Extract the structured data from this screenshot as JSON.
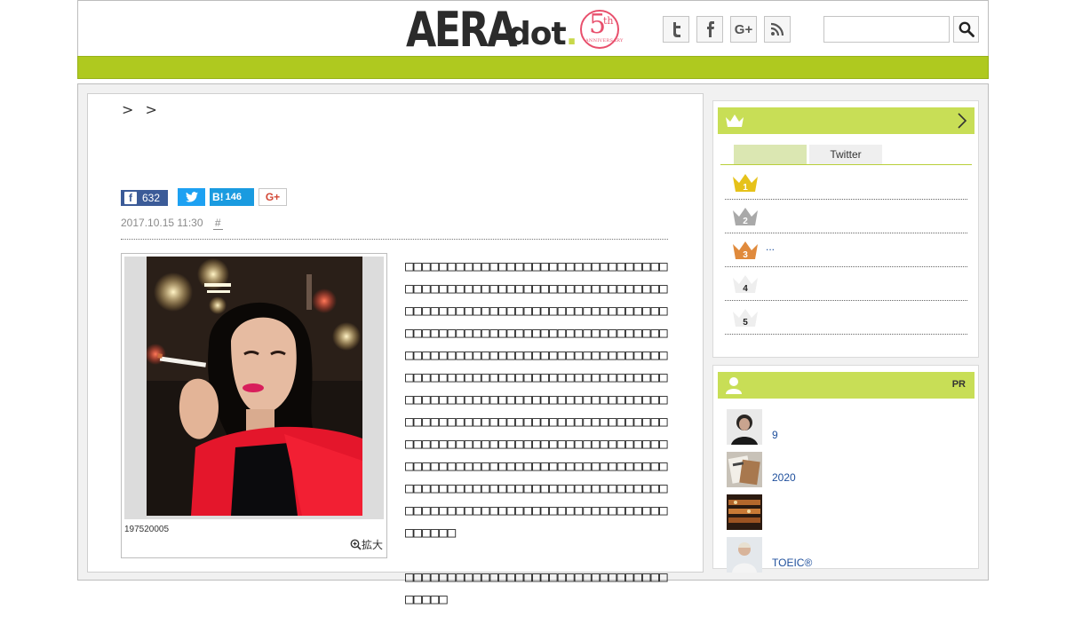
{
  "header": {
    "logo_main": "AERA",
    "logo_sub": "dot",
    "logo_period": ".",
    "logo_badge_number": "5",
    "logo_badge_suffix": "th",
    "logo_badge_text": "ANNIVERSARY",
    "social": [
      {
        "name": "twitter",
        "glyph": "t"
      },
      {
        "name": "facebook",
        "glyph": "f"
      },
      {
        "name": "google-plus",
        "glyph": "G+"
      },
      {
        "name": "rss",
        "glyph": "rss"
      }
    ],
    "search_placeholder": ""
  },
  "colors": {
    "brand_green": "#afc91f",
    "side_head_green": "#c8de56",
    "link_blue": "#1e4f9c",
    "facebook_blue": "#3b5b98",
    "twitter_blue": "#1da1f2",
    "hatena_blue": "#1a9be0",
    "gplus_red": "#d34836",
    "gold": "#e6c21a",
    "silver": "#a9a9a9",
    "bronze": "#e08a3c"
  },
  "article": {
    "breadcrumb": [
      ">",
      ">"
    ],
    "share": {
      "facebook_count": "632",
      "hatena_label": "B!",
      "hatena_count": "146",
      "gplus_label": "G+"
    },
    "date": "2017.10.15 11:30",
    "tag": "#",
    "photo_caption": "197520005",
    "zoom_label": "拡大",
    "paragraphs": [
      "□□□□□□□□□□□□□□□□□□□□□□□□□□□□□□□□□□□□□□□□□□□□□□□□□□□□□□□□□□□□□□□□□□□□□□□□□□□□□□□□□□□□□□□□□□□□□□□□□□□□□□□□□□□□□□□□□□□□□□□□□□□□□□□□□□□□□□□□□□□□□□□□□□□□□□□□□□□□□□□□□□□□□□□□□□□□□□□□□□□□□□□□□□□□□□□□□□□□□□□□□□□□□□□□□□□□□□□□□□□□□□□□□□□□□□□□□□□□□□□□□□□□□□□□□□□□□□□□□□□□□□□□□□□□□□□□□□□□□□□□□□□□□□□□□□□□□□□□□□□□□□□□□□□□□□□□□□□□□□□□□□□□□□□□□□□□□□□□□□□□□□□□□□□□□□□□□□□□□□□□□□□□□□□□□□□□□□□□□□",
      "□□□□□□□□□□□□□□□□□□□□□□□□□□□□□□□□□□□□"
    ]
  },
  "ranking": {
    "tab_active": "",
    "tab_twitter": "Twitter",
    "items": [
      {
        "rank": "1",
        "text": ""
      },
      {
        "rank": "2",
        "text": ""
      },
      {
        "rank": "3",
        "text": "..."
      },
      {
        "rank": "4",
        "text": ""
      },
      {
        "rank": "5",
        "text": ""
      }
    ]
  },
  "pr": {
    "head_label": "PR",
    "items": [
      {
        "text": "9",
        "thumb": "portrait"
      },
      {
        "text": "2020",
        "thumb": "magazine"
      },
      {
        "text": "",
        "thumb": "food"
      },
      {
        "text": "TOEIC®",
        "thumb": "person"
      }
    ]
  }
}
